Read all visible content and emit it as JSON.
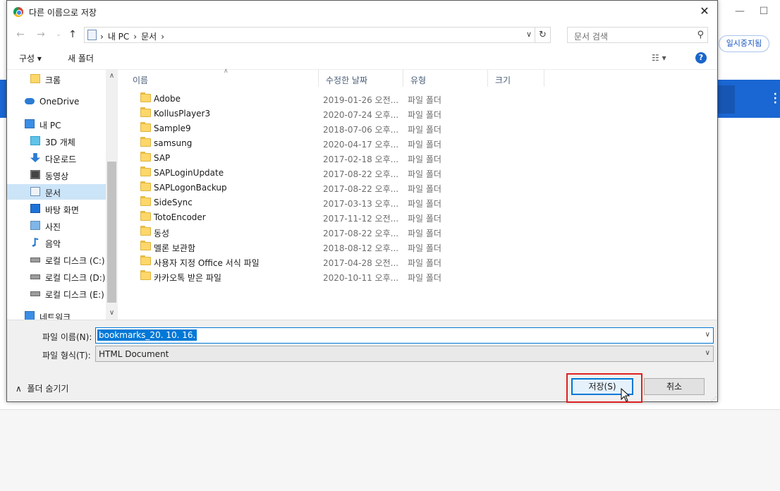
{
  "background": {
    "status_button": "일시중지됨"
  },
  "dialog": {
    "title": "다른 이름으로 저장",
    "address": [
      "내 PC",
      "문서"
    ],
    "search_placeholder": "문서 검색",
    "toolbar": {
      "organize": "구성 ▾",
      "new_folder": "새 폴더"
    },
    "sidebar": [
      {
        "label": "크롬",
        "icon": "folder-icon",
        "selected": false
      },
      {
        "label": "OneDrive",
        "icon": "cloud-icon",
        "selected": false
      },
      {
        "label": "내 PC",
        "icon": "computer-icon",
        "selected": false
      },
      {
        "label": "3D 개체",
        "icon": "cube-icon",
        "selected": false
      },
      {
        "label": "다운로드",
        "icon": "download-icon",
        "selected": false
      },
      {
        "label": "동영상",
        "icon": "video-icon",
        "selected": false
      },
      {
        "label": "문서",
        "icon": "document-icon",
        "selected": true
      },
      {
        "label": "바탕 화면",
        "icon": "desktop-icon",
        "selected": false
      },
      {
        "label": "사진",
        "icon": "picture-icon",
        "selected": false
      },
      {
        "label": "음악",
        "icon": "music-icon",
        "selected": false
      },
      {
        "label": "로컬 디스크 (C:)",
        "icon": "drive-icon",
        "selected": false
      },
      {
        "label": "로컬 디스크 (D:)",
        "icon": "drive-icon",
        "selected": false
      },
      {
        "label": "로컬 디스크 (E:)",
        "icon": "drive-icon",
        "selected": false
      },
      {
        "label": "네트워크",
        "icon": "network-icon",
        "selected": false
      }
    ],
    "columns": {
      "name": "이름",
      "modified": "수정한 날짜",
      "type": "유형",
      "size": "크기"
    },
    "files": [
      {
        "name": "Adobe",
        "date": "2019-01-26 오전...",
        "type": "파일 폴더"
      },
      {
        "name": "KollusPlayer3",
        "date": "2020-07-24 오후...",
        "type": "파일 폴더"
      },
      {
        "name": "Sample9",
        "date": "2018-07-06 오후...",
        "type": "파일 폴더"
      },
      {
        "name": "samsung",
        "date": "2020-04-17 오후...",
        "type": "파일 폴더"
      },
      {
        "name": "SAP",
        "date": "2017-02-18 오후...",
        "type": "파일 폴더"
      },
      {
        "name": "SAPLoginUpdate",
        "date": "2017-08-22 오후...",
        "type": "파일 폴더"
      },
      {
        "name": "SAPLogonBackup",
        "date": "2017-08-22 오후...",
        "type": "파일 폴더"
      },
      {
        "name": "SideSync",
        "date": "2017-03-13 오후...",
        "type": "파일 폴더"
      },
      {
        "name": "TotoEncoder",
        "date": "2017-11-12 오전...",
        "type": "파일 폴더"
      },
      {
        "name": "동성",
        "date": "2017-08-22 오후...",
        "type": "파일 폴더"
      },
      {
        "name": "멜론 보관함",
        "date": "2018-08-12 오후...",
        "type": "파일 폴더"
      },
      {
        "name": "사용자 지정 Office 서식 파일",
        "date": "2017-04-28 오전...",
        "type": "파일 폴더"
      },
      {
        "name": "카카오톡 받은 파일",
        "date": "2020-10-11 오후...",
        "type": "파일 폴더"
      }
    ],
    "filename_label": "파일 이름(N):",
    "filename_value": "bookmarks_20. 10. 16.",
    "filetype_label": "파일 형식(T):",
    "filetype_value": "HTML Document",
    "hide_folders": "폴더 숨기기",
    "save_button": "저장(S)",
    "cancel_button": "취소",
    "highlight_color": "#e02020",
    "accent_color": "#0078d7"
  }
}
